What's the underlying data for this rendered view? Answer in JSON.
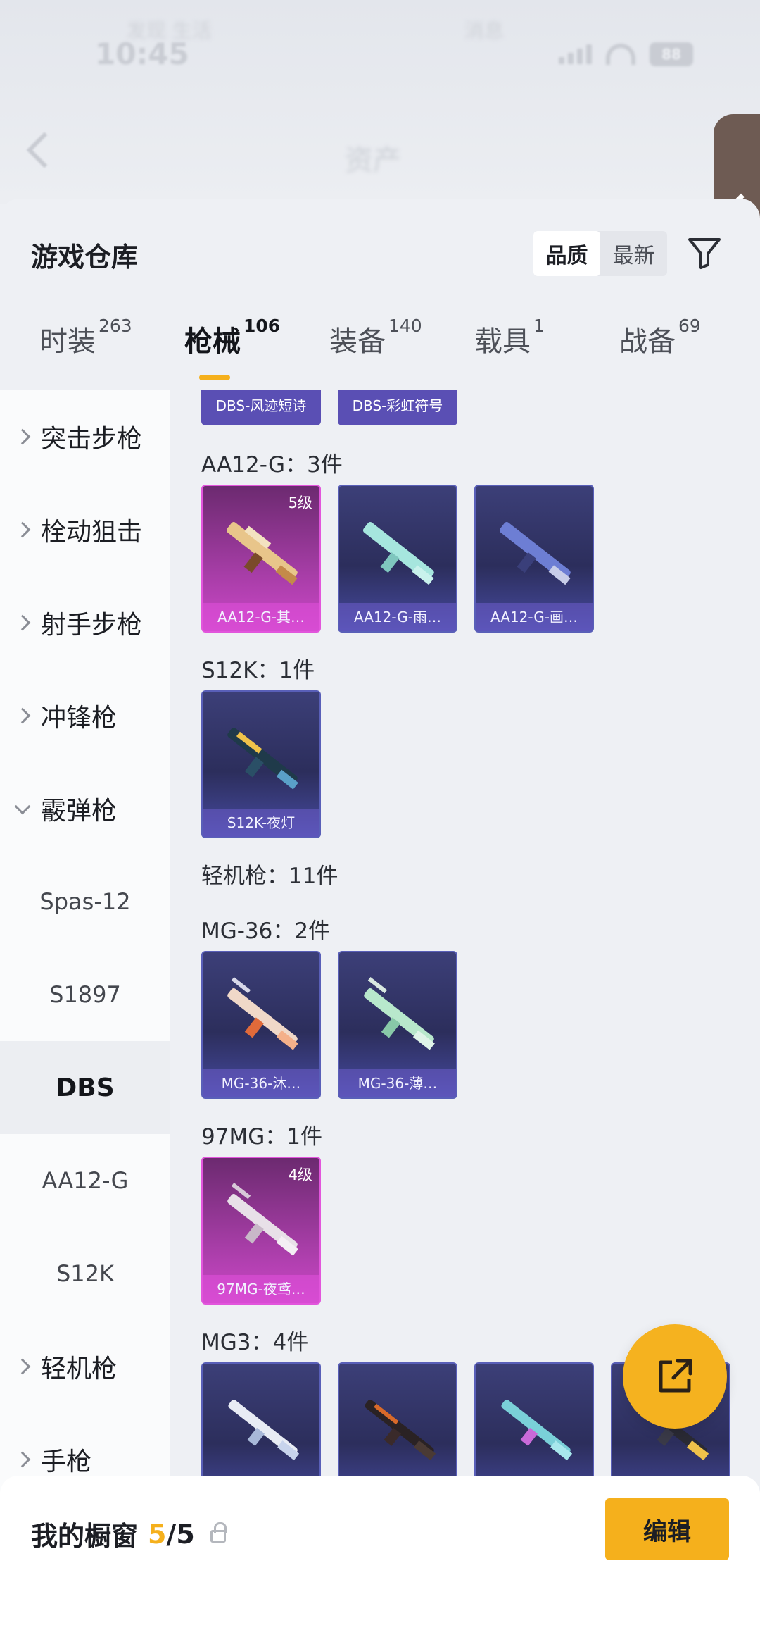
{
  "status": {
    "time": "10:45",
    "battery": "88",
    "ghost_left": "发现 生活",
    "ghost_right": "消息"
  },
  "header": {
    "blur_title": "资产"
  },
  "sheet": {
    "title": "游戏仓库",
    "sort": {
      "quality": "品质",
      "latest": "最新"
    }
  },
  "tabs": [
    {
      "label": "时装",
      "count": "263"
    },
    {
      "label": "枪械",
      "count": "106"
    },
    {
      "label": "装备",
      "count": "140"
    },
    {
      "label": "载具",
      "count": "1"
    },
    {
      "label": "战备",
      "count": "69"
    }
  ],
  "categories": [
    {
      "label": "突击步枪"
    },
    {
      "label": "栓动狙击"
    },
    {
      "label": "射手步枪"
    },
    {
      "label": "冲锋枪"
    },
    {
      "label": "霰弹枪"
    },
    {
      "label": "Spas-12"
    },
    {
      "label": "S1897"
    },
    {
      "label": "DBS"
    },
    {
      "label": "AA12-G"
    },
    {
      "label": "S12K"
    },
    {
      "label": "轻机枪"
    },
    {
      "label": "手枪"
    }
  ],
  "content": {
    "top_strip": [
      "DBS-风迹短诗",
      "DBS-彩虹符号"
    ],
    "groups": [
      {
        "label": "AA12-G：3件",
        "items": [
          {
            "name": "AA12-G-其…",
            "level": "5级",
            "rarity": "pink"
          },
          {
            "name": "AA12-G-雨…",
            "level": "",
            "rarity": "purple"
          },
          {
            "name": "AA12-G-画…",
            "level": "",
            "rarity": "purple"
          }
        ]
      },
      {
        "label": "S12K：1件",
        "items": [
          {
            "name": "S12K-夜灯",
            "level": "",
            "rarity": "purple"
          }
        ]
      },
      {
        "label": "轻机枪：11件",
        "items": []
      },
      {
        "label": "MG-36：2件",
        "items": [
          {
            "name": "MG-36-沐…",
            "level": "",
            "rarity": "purple"
          },
          {
            "name": "MG-36-薄…",
            "level": "",
            "rarity": "purple"
          }
        ]
      },
      {
        "label": "97MG：1件",
        "items": [
          {
            "name": "97MG-夜鸢…",
            "level": "4级",
            "rarity": "pink"
          }
        ]
      },
      {
        "label": "MG3：4件",
        "items": [
          {
            "name": "",
            "level": "",
            "rarity": "purple"
          },
          {
            "name": "",
            "level": "",
            "rarity": "purple"
          },
          {
            "name": "",
            "level": "",
            "rarity": "purple"
          },
          {
            "name": "",
            "level": "",
            "rarity": "purple"
          }
        ]
      }
    ]
  },
  "bottom": {
    "showcase_label": "我的橱窗",
    "showcase_used": "5",
    "showcase_sep": "/",
    "showcase_total": "5",
    "edit_label": "编辑"
  },
  "colors": {
    "accent": "#f5b01c",
    "purple_card": "#2c2e5c",
    "pink_card": "#a63da6"
  },
  "icons": [
    "back-icon",
    "filter-icon",
    "chevron-right-icon",
    "chevron-down-icon",
    "share-icon",
    "lock-icon",
    "side-handle-chevron-icon"
  ]
}
